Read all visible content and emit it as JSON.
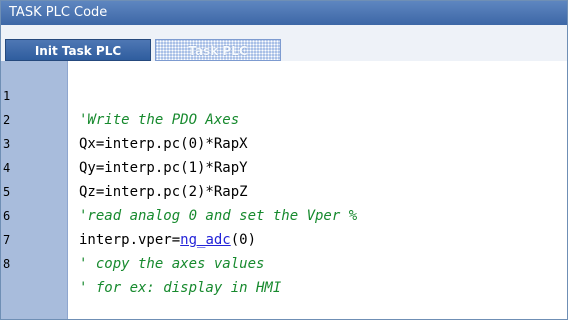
{
  "window": {
    "title": "TASK PLC Code"
  },
  "tabs": [
    {
      "label": "Init Task PLC",
      "active": true
    },
    {
      "label": "Task PLC",
      "active": false
    }
  ],
  "editor": {
    "lines": [
      {
        "num": "1",
        "comment": "'Write the PDO Axes"
      },
      {
        "num": "2",
        "code": "Qx=interp.pc(0)*RapX"
      },
      {
        "num": "3",
        "code": "Qy=interp.pc(1)*RapY"
      },
      {
        "num": "4",
        "code": "Qz=interp.pc(2)*RapZ"
      },
      {
        "num": "5",
        "comment": "'read analog 0 and set the Vper %"
      },
      {
        "num": "6",
        "pre": "interp.vper=",
        "fn": "ng_adc",
        "post": "(0)"
      },
      {
        "num": "7",
        "comment": "' copy the axes values"
      },
      {
        "num": "8",
        "comment": "' for ex: display in HMI"
      }
    ]
  },
  "colors": {
    "comment": "#178a2e",
    "function": "#2323d8",
    "gutter": "#a8bcdc",
    "title_bar": "#3d67a6"
  }
}
